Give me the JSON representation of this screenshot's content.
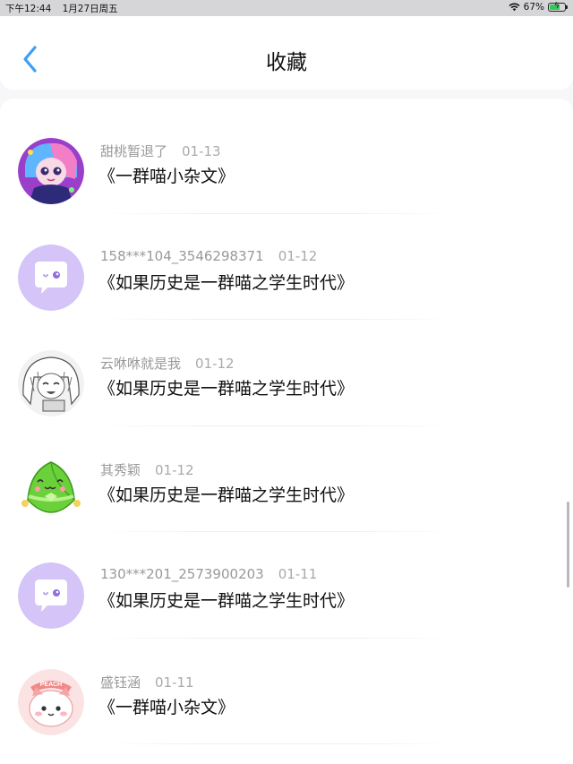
{
  "status": {
    "time": "下午12:44",
    "date": "1月27日周五",
    "battery_percent": "67%",
    "battery_level": 0.67,
    "battery_color": "#34c759"
  },
  "nav": {
    "back_icon": "chevron-left-icon",
    "title": "收藏",
    "accent_color": "#3e9ff2"
  },
  "favorites": [
    {
      "user": "甜桃暂退了",
      "date": "01-13",
      "title": "《一群喵小杂文》",
      "avatar": "anime-girl-colorful"
    },
    {
      "user": "158***104_3546298371",
      "date": "01-12",
      "title": "《如果历史是一群喵之学生时代》",
      "avatar": "default-chat-bubble"
    },
    {
      "user": "云咻咻就是我",
      "date": "01-12",
      "title": "《如果历史是一群喵之学生时代》",
      "avatar": "anime-girl-sketch"
    },
    {
      "user": "其秀颖",
      "date": "01-12",
      "title": "《如果历史是一群喵之学生时代》",
      "avatar": "green-zongzi"
    },
    {
      "user": "130***201_2573900203",
      "date": "01-11",
      "title": "《如果历史是一群喵之学生时代》",
      "avatar": "default-chat-bubble"
    },
    {
      "user": "盛钰涵",
      "date": "01-11",
      "title": "《一群喵小杂文》",
      "avatar": "peach-cat"
    }
  ]
}
